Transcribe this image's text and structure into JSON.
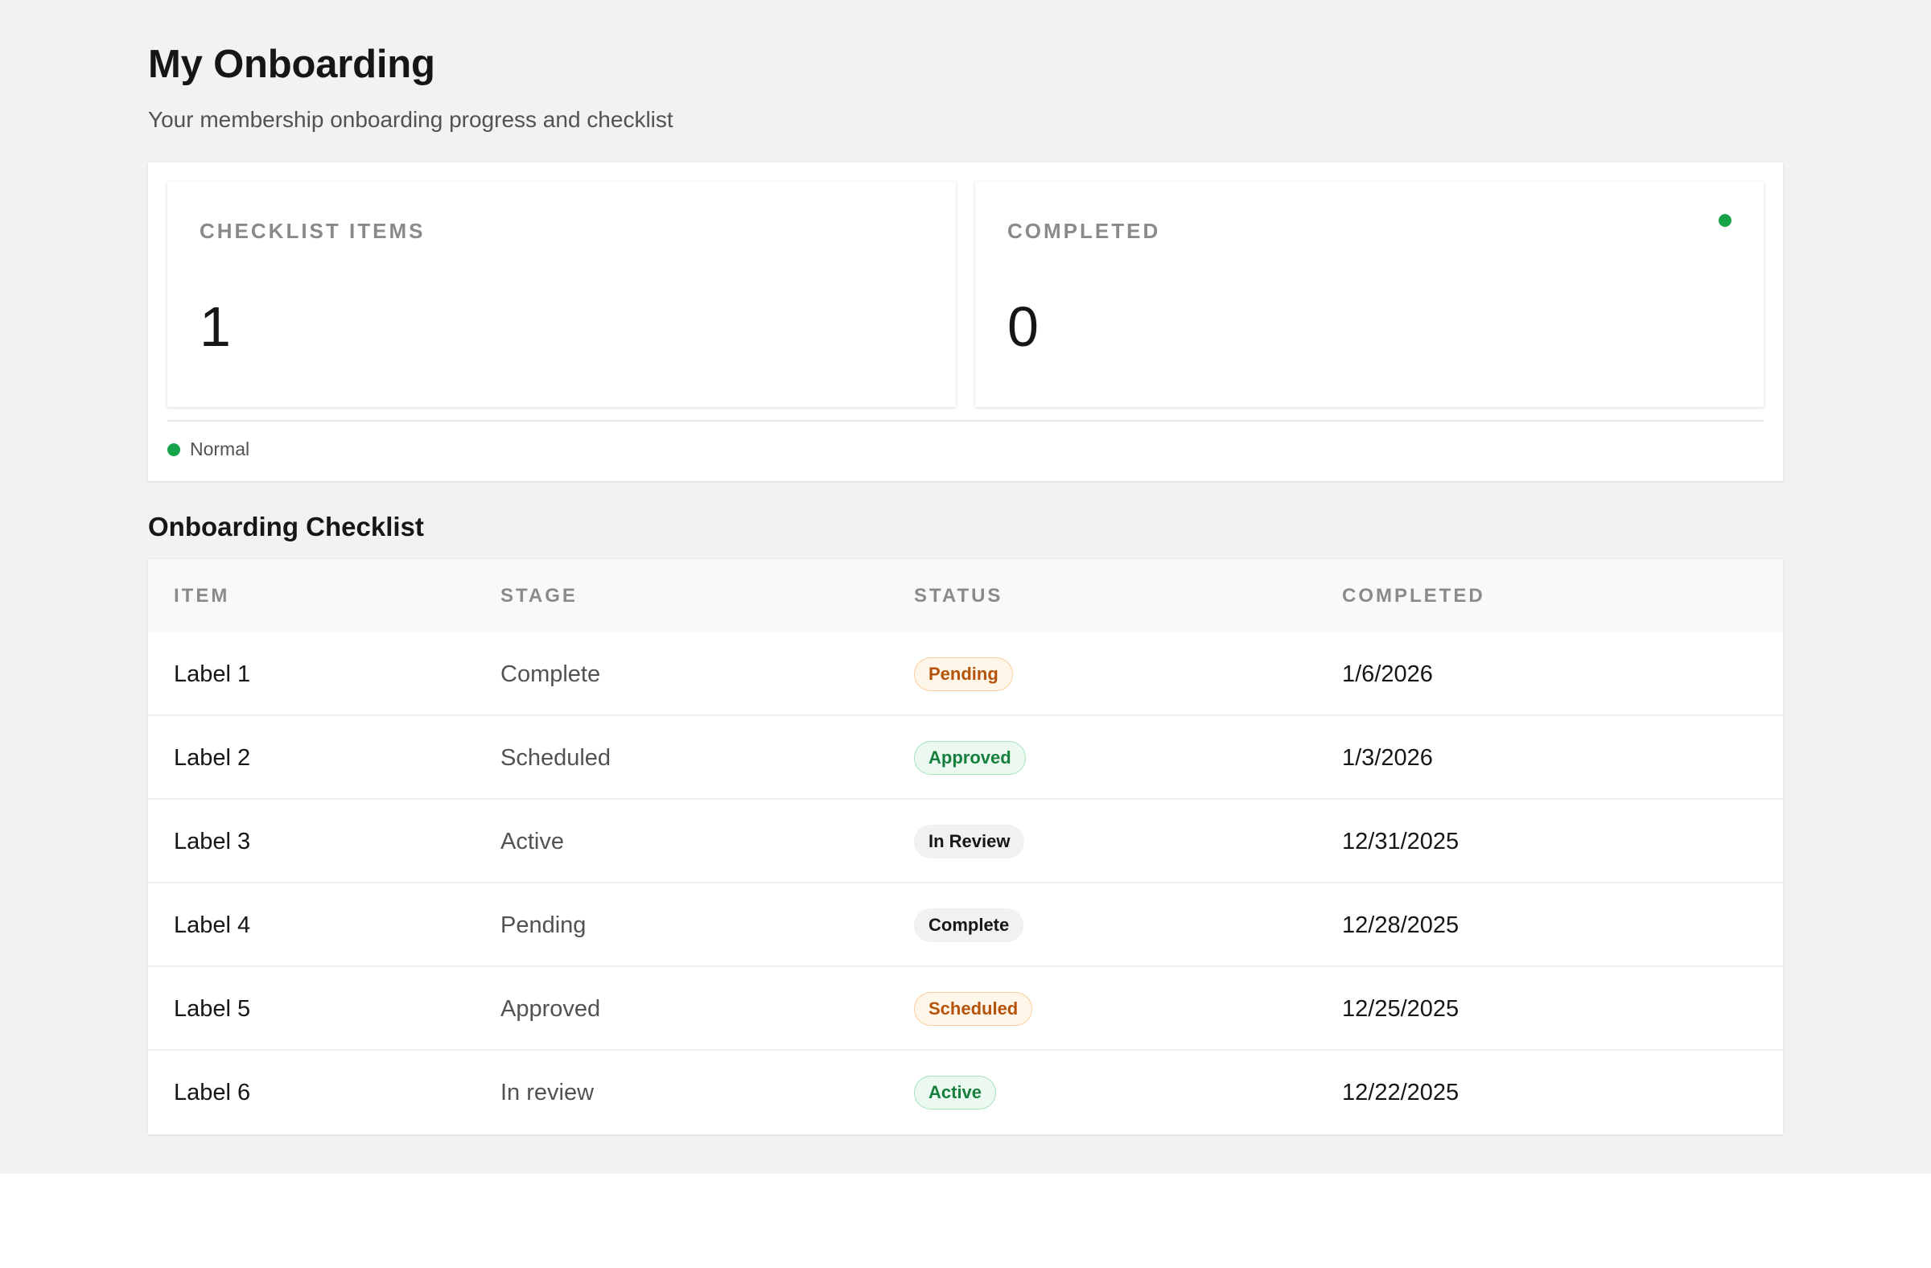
{
  "header": {
    "title": "My Onboarding",
    "subtitle": "Your membership onboarding progress and checklist"
  },
  "stats": {
    "cards": [
      {
        "label": "CHECKLIST ITEMS",
        "value": "1"
      },
      {
        "label": "COMPLETED",
        "value": "0",
        "indicator_color": "#16a34a"
      }
    ],
    "legend": {
      "label": "Normal",
      "color": "#16a34a"
    }
  },
  "checklist": {
    "title": "Onboarding Checklist",
    "columns": [
      "ITEM",
      "STAGE",
      "STATUS",
      "COMPLETED"
    ],
    "rows": [
      {
        "item": "Label 1",
        "stage": "Complete",
        "status": "Pending",
        "status_tone": "warning",
        "completed": "1/6/2026"
      },
      {
        "item": "Label 2",
        "stage": "Scheduled",
        "status": "Approved",
        "status_tone": "success",
        "completed": "1/3/2026"
      },
      {
        "item": "Label 3",
        "stage": "Active",
        "status": "In Review",
        "status_tone": "neutral",
        "completed": "12/31/2025"
      },
      {
        "item": "Label 4",
        "stage": "Pending",
        "status": "Complete",
        "status_tone": "neutral",
        "completed": "12/28/2025"
      },
      {
        "item": "Label 5",
        "stage": "Approved",
        "status": "Scheduled",
        "status_tone": "warning",
        "completed": "12/25/2025"
      },
      {
        "item": "Label 6",
        "stage": "In review",
        "status": "Active",
        "status_tone": "success",
        "completed": "12/22/2025"
      }
    ]
  },
  "colors": {
    "page_background": "#f2f2f2",
    "accent_green": "#16a34a",
    "badge_warning_text": "#b45309",
    "badge_success_text": "#15803d"
  }
}
